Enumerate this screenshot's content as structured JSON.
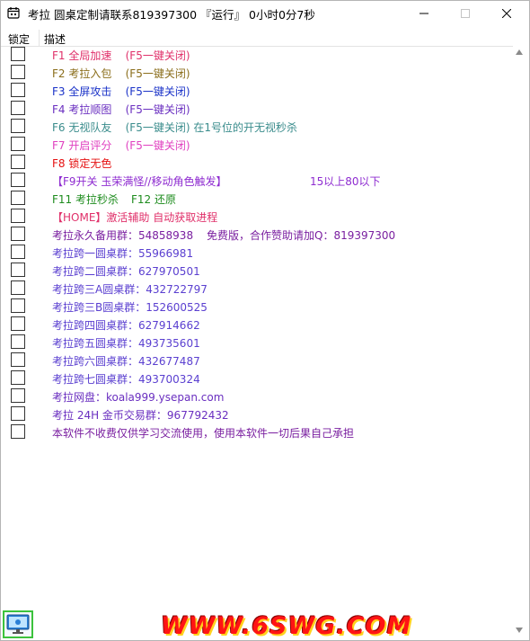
{
  "window": {
    "title": "考拉  圆桌定制请联系819397300 『运行』 0小时0分7秒"
  },
  "header": {
    "lock": "锁定",
    "desc": "描述"
  },
  "colors": {
    "pink": "#e0306a",
    "olive": "#8a6d1a",
    "blue": "#1a32c8",
    "purple": "#6a2fc0",
    "teal": "#3a8c8c",
    "magenta": "#e040c0",
    "red": "#e51010",
    "green": "#1e8c1e",
    "violet": "#8e2bd0",
    "indigo": "#5a3fd0",
    "deep_purple": "#7a1fa0"
  },
  "rows": [
    {
      "text": "F1 全局加速    (F5一键关闭)"
    },
    {
      "text": "F2 考拉入包    (F5一键关闭)"
    },
    {
      "text": "F3 全屏攻击    (F5一键关闭)"
    },
    {
      "text": "F4 考拉顺图    (F5一键关闭)"
    },
    {
      "text": "F6 无视队友    (F5一键关闭) 在1号位的开无视秒杀"
    },
    {
      "text": "F7 开启评分    (F5一键关闭)"
    },
    {
      "text": "F8 锁定无色"
    },
    {
      "text": "【F9开关 玉荣满怪//移动角色触发】",
      "text2": "15以上80以下"
    },
    {
      "text": "F11 考拉秒杀",
      "text2": "F12 还原"
    },
    {
      "text": "【HOME】激活辅助 自动获取进程"
    },
    {
      "text": "考拉永久备用群：54858938",
      "text2": "免费版，合作赞助请加Q：819397300"
    },
    {
      "text": "考拉跨一圆桌群：55966981"
    },
    {
      "text": "考拉跨二圆桌群：627970501"
    },
    {
      "text": "考拉跨三A圆桌群：432722797"
    },
    {
      "text": "考拉跨三B圆桌群：152600525"
    },
    {
      "text": "考拉跨四圆桌群：627914662"
    },
    {
      "text": "考拉跨五圆桌群：493735601"
    },
    {
      "text": "考拉跨六圆桌群：432677487"
    },
    {
      "text": "考拉跨七圆桌群：493700324"
    },
    {
      "text": "考拉网盘：koala999.ysepan.com"
    },
    {
      "text": "考拉 24H 金币交易群：967792432"
    },
    {
      "text": "本软件不收费仅供学习交流使用，使用本软件一切后果自己承担"
    }
  ],
  "watermark": "WWW.6SWG.COM",
  "icons": {
    "app": "calendar-icon",
    "minimize": "minimize-icon",
    "maximize": "maximize-icon",
    "close": "close-icon",
    "taskbar": "monitor-icon"
  }
}
